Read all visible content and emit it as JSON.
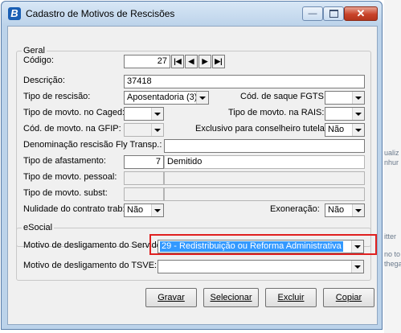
{
  "window": {
    "title": "Cadastro de Motivos de Rescisões",
    "app_icon": "B"
  },
  "geral": {
    "legend": "Geral",
    "codigo": {
      "label": "Código:",
      "value": "27"
    },
    "nav": [
      "|◀",
      "◀",
      "▶",
      "▶|"
    ],
    "descricao": {
      "label": "Descrição:",
      "value": "37418"
    },
    "tipo_rescisao": {
      "label": "Tipo de rescisão:",
      "value": "Aposentadoria (3)"
    },
    "cod_saque_fgts": {
      "label": "Cód. de saque FGTS:",
      "value": ""
    },
    "tipo_movto_caged": {
      "label": "Tipo de movto. no Caged:",
      "value": ""
    },
    "tipo_movto_rais": {
      "label": "Tipo de movto. na RAIS:",
      "value": ""
    },
    "cod_movto_gfip": {
      "label": "Cód. de movto. na GFIP:",
      "value": ""
    },
    "exclusivo_conselheiro": {
      "label": "Exclusivo para conselheiro tutelar:",
      "value": "Não"
    },
    "denominacao_fly": {
      "label": "Denominação rescisão Fly Transp.:",
      "value": ""
    },
    "tipo_afastamento": {
      "label": "Tipo de afastamento:",
      "code": "7",
      "desc": "Demitido"
    },
    "tipo_movto_pessoal": {
      "label": "Tipo de movto. pessoal:"
    },
    "tipo_movto_subst": {
      "label": "Tipo de movto. subst:"
    },
    "nulidade_contrato": {
      "label": "Nulidade do contrato trab:",
      "value": "Não"
    },
    "exoneracao": {
      "label": "Exoneração:",
      "value": "Não"
    }
  },
  "esocial": {
    "legend": "eSocial",
    "motivo_servidor": {
      "label": "Motivo de desligamento do Servidor:",
      "value": "29 - Redistribuição ou Reforma Administrativa"
    },
    "motivo_tsve": {
      "label": "Motivo de desligamento do TSVE:",
      "value": ""
    }
  },
  "buttons": {
    "gravar": "Gravar",
    "selecionar": "Selecionar",
    "excluir": "Excluir",
    "copiar": "Copiar"
  },
  "background": {
    "lines": [
      "ualiz",
      "nhur",
      "itter",
      "no to",
      "thega"
    ]
  }
}
